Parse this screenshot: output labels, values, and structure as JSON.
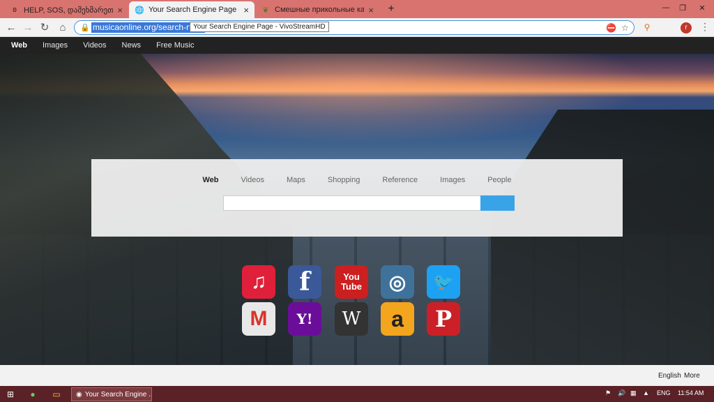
{
  "browser": {
    "tabs": [
      {
        "title": "HELP, SOS, დამეხმარეთ მხოლ",
        "favicon": "ghost-icon"
      },
      {
        "title": "Your Search Engine Page - VivoS",
        "favicon": "globe-icon"
      },
      {
        "title": "Смешные прикольные картинк",
        "favicon": "leaf-icon"
      }
    ],
    "url": "musicaonline.org/search-now/",
    "tooltip": "Your Search Engine Page - VivoStreamHD",
    "profile_initial": "r"
  },
  "sitenav": {
    "items": [
      "Web",
      "Images",
      "Videos",
      "News",
      "Free Music"
    ]
  },
  "search": {
    "tabs": [
      "Web",
      "Videos",
      "Maps",
      "Shopping",
      "Reference",
      "Images",
      "People"
    ],
    "placeholder": ""
  },
  "apps": [
    {
      "name": "itunes-icon",
      "glyph": "♫",
      "color": "#e0203a"
    },
    {
      "name": "facebook-icon",
      "glyph": "f",
      "color": "#3b5998"
    },
    {
      "name": "youtube-icon",
      "glyph": "You\nTube",
      "color": "#cc1f1f"
    },
    {
      "name": "instagram-icon",
      "glyph": "◎",
      "color": "#3f729b"
    },
    {
      "name": "twitter-icon",
      "glyph": "🐦",
      "color": "#1da1f2"
    },
    {
      "name": "gmail-icon",
      "glyph": "M",
      "color": "#e8e8e8"
    },
    {
      "name": "yahoo-icon",
      "glyph": "Y!",
      "color": "#6a0e9a"
    },
    {
      "name": "wikipedia-icon",
      "glyph": "W",
      "color": "#333333"
    },
    {
      "name": "amazon-icon",
      "glyph": "a",
      "color": "#f3a51d"
    },
    {
      "name": "pinterest-icon",
      "glyph": "P",
      "color": "#cb2027"
    }
  ],
  "footer": {
    "english": "English",
    "more": "More"
  },
  "taskbar": {
    "task_label": "Your Search Engine ...",
    "lang": "ENG",
    "time": "11:54 AM"
  }
}
